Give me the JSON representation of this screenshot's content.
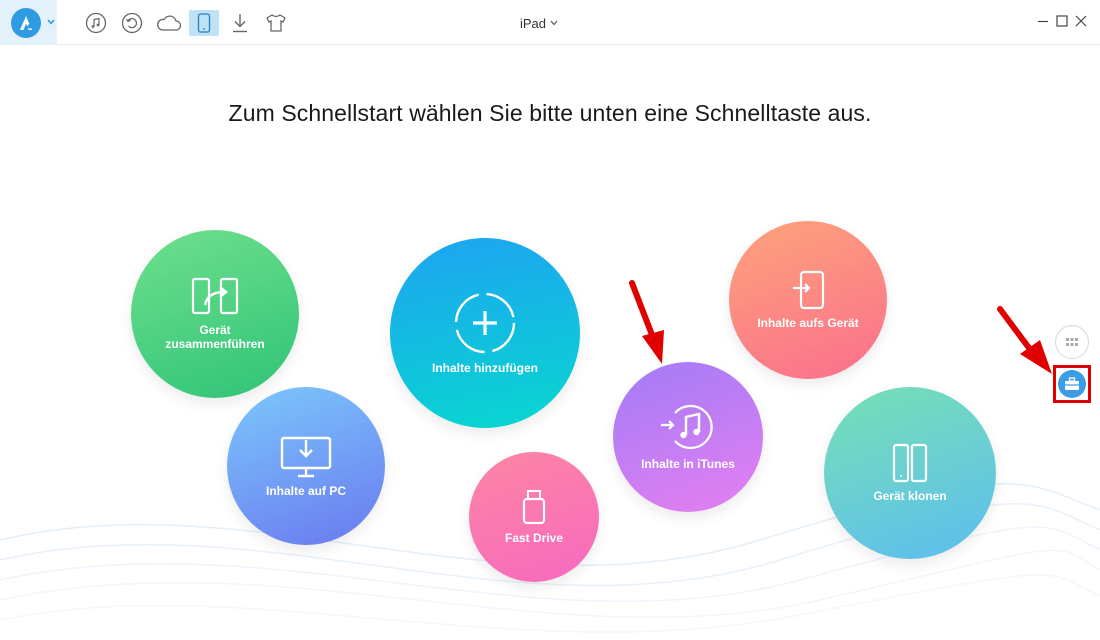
{
  "header": {
    "device_name": "iPad",
    "toolbar_icons": [
      "music-icon",
      "restore-icon",
      "cloud-icon",
      "device-icon",
      "download-icon",
      "tshirt-icon"
    ],
    "active_tool": "device-icon"
  },
  "main": {
    "headline": "Zum Schnellstart wählen Sie bitte unten eine Schnelltaste aus.",
    "tiles": {
      "merge": "Gerät\nzusammenführen",
      "to_pc": "Inhalte auf PC",
      "add": "Inhalte hinzufügen",
      "fast_drive": "Fast Drive",
      "to_itunes": "Inhalte in iTunes",
      "to_device": "Inhalte aufs Gerät",
      "clone": "Gerät klonen"
    }
  },
  "side_buttons": [
    "grid-icon",
    "toolbox-icon"
  ],
  "colors": {
    "accent": "#2f9be3",
    "highlight": "#e10000"
  }
}
